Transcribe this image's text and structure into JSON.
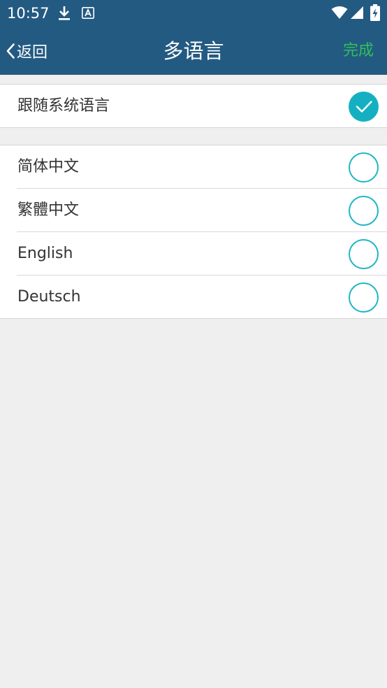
{
  "status_bar": {
    "time": "10:57",
    "icons": [
      "download-icon",
      "font-app-icon",
      "wifi-icon",
      "cellular-signal-icon",
      "battery-charging-icon"
    ]
  },
  "navbar": {
    "back_label": "返回",
    "title": "多语言",
    "done_label": "完成"
  },
  "follow_system": {
    "label": "跟随系统语言",
    "selected": true
  },
  "languages": [
    {
      "label": "简体中文",
      "selected": false
    },
    {
      "label": "繁體中文",
      "selected": false
    },
    {
      "label": "English",
      "selected": false
    },
    {
      "label": "Deutsch",
      "selected": false
    }
  ],
  "colors": {
    "header_bg": "#235a82",
    "done_text": "#2fc05a",
    "check_accent": "#14b0c2",
    "page_bg": "#efefef"
  }
}
